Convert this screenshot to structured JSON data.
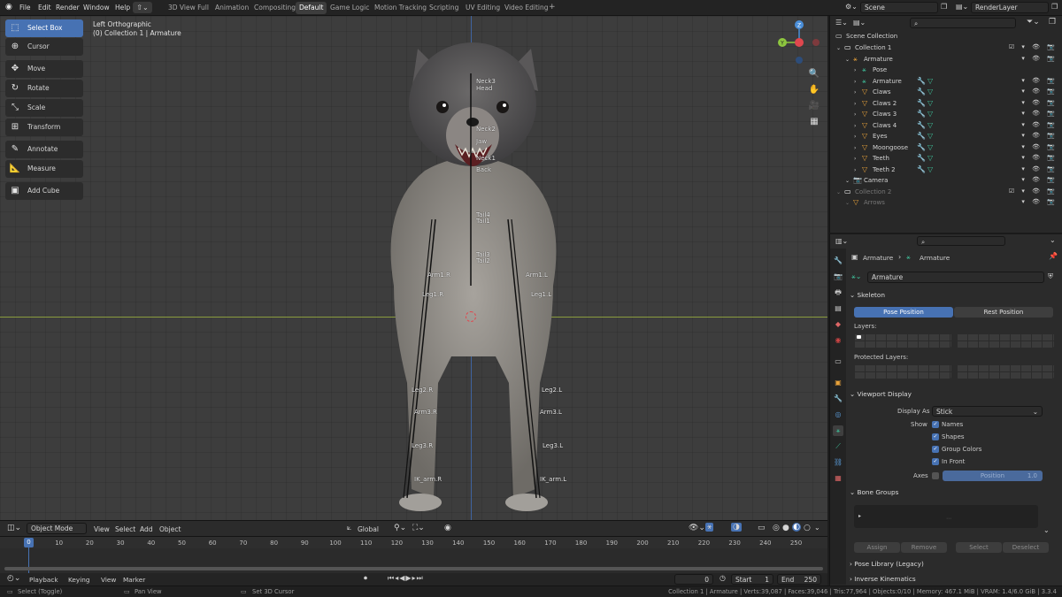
{
  "menu": [
    "File",
    "Edit",
    "Render",
    "Window",
    "Help"
  ],
  "workspaces": [
    "3D View Full",
    "Animation",
    "Compositing",
    "Default",
    "Game Logic",
    "Motion Tracking",
    "Scripting",
    "UV Editing",
    "Video Editing"
  ],
  "active_workspace": "Default",
  "scene": {
    "label": "Scene",
    "layer": "RenderLayer"
  },
  "viewport": {
    "view_name": "Left Orthographic",
    "context": "(0) Collection 1 | Armature"
  },
  "tools": [
    "Select Box",
    "Cursor",
    "Move",
    "Rotate",
    "Scale",
    "Transform",
    "Annotate",
    "Measure",
    "Add Cube"
  ],
  "bone_labels": [
    "Neck3",
    "Head",
    "Neck2",
    "Jaw",
    "Neck1",
    "Back",
    "Tail4",
    "Tail1",
    "Tail3",
    "Tail2",
    "Arm1.R",
    "Arm1.L",
    "Leg1.R",
    "Leg1.L",
    "Leg2.R",
    "Leg2.L",
    "Arm3.R",
    "Arm3.L",
    "Leg3.R",
    "Leg3.L",
    "IK_arm.R",
    "IK_arm.L"
  ],
  "vheader": {
    "mode": "Object Mode",
    "view": "View",
    "select": "Select",
    "add": "Add",
    "object": "Object",
    "orientation": "Global"
  },
  "timeline": {
    "ticks": [
      "0",
      "10",
      "20",
      "30",
      "40",
      "50",
      "60",
      "70",
      "80",
      "90",
      "100",
      "110",
      "120",
      "130",
      "140",
      "150",
      "160",
      "170",
      "180",
      "190",
      "200",
      "210",
      "220",
      "230",
      "240",
      "250"
    ],
    "current_frame": "0",
    "playback": "Playback",
    "keying": "Keying",
    "view": "View",
    "marker": "Marker",
    "frame_field": "0",
    "start_label": "Start",
    "start": "1",
    "end_label": "End",
    "end": "250"
  },
  "status": {
    "left1": "Select (Toggle)",
    "left2": "Pan View",
    "left3": "Set 3D Cursor",
    "right": "Collection 1 | Armature | Verts:39,087 | Faces:39,046 | Tris:77,964 | Objects:0/10 | Memory: 467.1 MiB | VRAM: 1.4/6.0 GiB | 3.3.4"
  },
  "outliner": {
    "root": "Scene Collection",
    "items": [
      {
        "label": "Collection 1",
        "depth": 1,
        "icon": "collection-icon"
      },
      {
        "label": "Armature",
        "depth": 2,
        "icon": "armature-icon"
      },
      {
        "label": "Pose",
        "depth": 3,
        "icon": "pose-icon"
      },
      {
        "label": "Armature",
        "depth": 3,
        "icon": "armature-data-icon"
      },
      {
        "label": "Claws",
        "depth": 3,
        "icon": "mesh-icon"
      },
      {
        "label": "Claws 2",
        "depth": 3,
        "icon": "mesh-icon"
      },
      {
        "label": "Claws 3",
        "depth": 3,
        "icon": "mesh-icon"
      },
      {
        "label": "Claws 4",
        "depth": 3,
        "icon": "mesh-icon"
      },
      {
        "label": "Eyes",
        "depth": 3,
        "icon": "mesh-icon"
      },
      {
        "label": "Moongoose",
        "depth": 3,
        "icon": "mesh-icon"
      },
      {
        "label": "Teeth",
        "depth": 3,
        "icon": "mesh-icon"
      },
      {
        "label": "Teeth 2",
        "depth": 3,
        "icon": "mesh-icon"
      },
      {
        "label": "Camera",
        "depth": 2,
        "icon": "camera-icon"
      },
      {
        "label": "Collection 2",
        "depth": 1,
        "icon": "collection-icon"
      },
      {
        "label": "Arrows",
        "depth": 2,
        "icon": "mesh-icon"
      }
    ]
  },
  "properties": {
    "breadcrumb": [
      "Armature",
      "Armature"
    ],
    "data_name": "Armature",
    "skeleton": "Skeleton",
    "pose_position": "Pose Position",
    "rest_position": "Rest Position",
    "layers": "Layers:",
    "protected_layers": "Protected Layers:",
    "viewport_display": "Viewport Display",
    "display_as_label": "Display As",
    "display_as": "Stick",
    "show_label": "Show",
    "show_options": [
      "Names",
      "Shapes",
      "Group Colors",
      "In Front"
    ],
    "axes_label": "Axes",
    "axes_position": "Position",
    "axes_value": "1.0",
    "bone_groups": "Bone Groups",
    "assign": "Assign",
    "remove": "Remove",
    "select": "Select",
    "deselect": "Deselect",
    "pose_library": "Pose Library (Legacy)",
    "inverse_kinematics": "Inverse Kinematics"
  },
  "colors": {
    "accent": "#4772b3",
    "x_axis": "#e0474e",
    "y_axis": "#8dc63f",
    "z_axis": "#4a8ed8"
  }
}
